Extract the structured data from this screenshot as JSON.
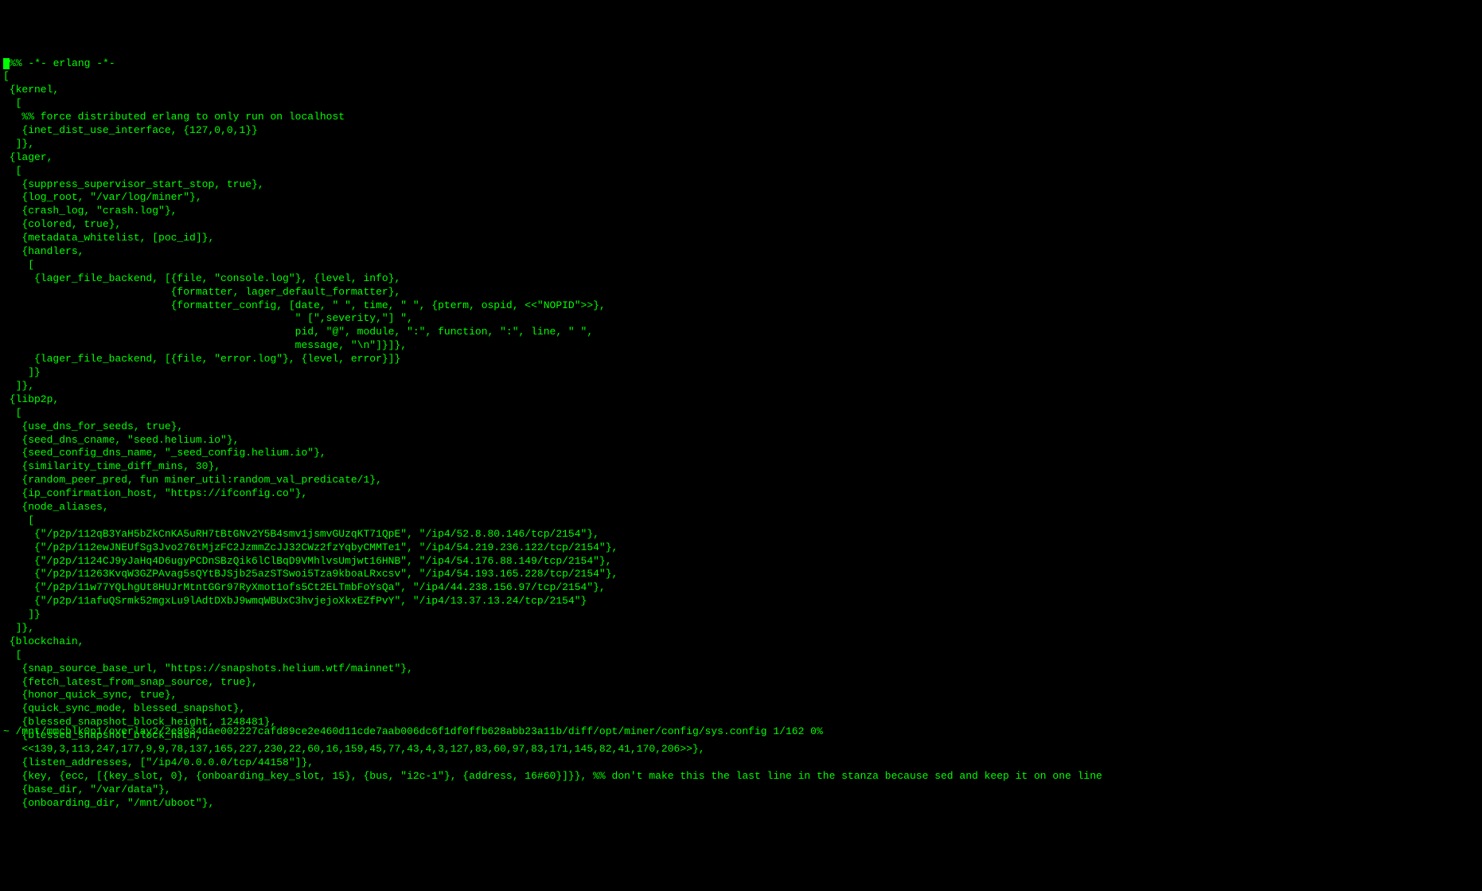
{
  "editor": {
    "lines": [
      "%% -*- erlang -*-",
      "[",
      " {kernel,",
      "  [",
      "   %% force distributed erlang to only run on localhost",
      "   {inet_dist_use_interface, {127,0,0,1}}",
      "  ]},",
      " {lager,",
      "  [",
      "   {suppress_supervisor_start_stop, true},",
      "   {log_root, \"/var/log/miner\"},",
      "   {crash_log, \"crash.log\"},",
      "   {colored, true},",
      "   {metadata_whitelist, [poc_id]},",
      "   {handlers,",
      "    [",
      "     {lager_file_backend, [{file, \"console.log\"}, {level, info},",
      "                           {formatter, lager_default_formatter},",
      "                           {formatter_config, [date, \" \", time, \" \", {pterm, ospid, <<\"NOPID\">>},",
      "                                               \" [\",severity,\"] \",",
      "                                               pid, \"@\", module, \":\", function, \":\", line, \" \",",
      "                                               message, \"\\n\"]}]},",
      "     {lager_file_backend, [{file, \"error.log\"}, {level, error}]}",
      "    ]}",
      "  ]},",
      " {libp2p,",
      "  [",
      "   {use_dns_for_seeds, true},",
      "   {seed_dns_cname, \"seed.helium.io\"},",
      "   {seed_config_dns_name, \"_seed_config.helium.io\"},",
      "   {similarity_time_diff_mins, 30},",
      "   {random_peer_pred, fun miner_util:random_val_predicate/1},",
      "   {ip_confirmation_host, \"https://ifconfig.co\"},",
      "   {node_aliases,",
      "    [",
      "     {\"/p2p/112qB3YaH5bZkCnKA5uRH7tBtGNv2Y5B4smv1jsmvGUzqKT71QpE\", \"/ip4/52.8.80.146/tcp/2154\"},",
      "     {\"/p2p/112ewJNEUfSg3Jvo276tMjzFC2JzmmZcJJ32CWz2fzYqbyCMMTe1\", \"/ip4/54.219.236.122/tcp/2154\"},",
      "     {\"/p2p/1124CJ9yJaHq4D6ugyPCDnSBzQik6lClBqD9VMhlvsUmjwt16HNB\", \"/ip4/54.176.88.149/tcp/2154\"},",
      "     {\"/p2p/11263KvqW3GZPAvag5sQYtBJSjb25azSTSwoi5Tza9kboaLRxcsv\", \"/ip4/54.193.165.228/tcp/2154\"},",
      "     {\"/p2p/11w77YQLhgUt8HUJrMtntGGr97RyXmot1ofs5Ct2ELTmbFoYsQa\", \"/ip4/44.238.156.97/tcp/2154\"},",
      "     {\"/p2p/11afuQSrmk52mgxLu9lAdtDXbJ9wmqWBUxC3hvjejoXkxEZfPvY\", \"/ip4/13.37.13.24/tcp/2154\"}",
      "    ]}",
      "  ]},",
      " {blockchain,",
      "  [",
      "   {snap_source_base_url, \"https://snapshots.helium.wtf/mainnet\"},",
      "   {fetch_latest_from_snap_source, true},",
      "   {honor_quick_sync, true},",
      "   {quick_sync_mode, blessed_snapshot},",
      "   {blessed_snapshot_block_height, 1248481},",
      "   {blessed_snapshot_block_hash,",
      "   <<139,3,113,247,177,9,9,78,137,165,227,230,22,60,16,159,45,77,43,4,3,127,83,60,97,83,171,145,82,41,170,206>>},",
      "   {listen_addresses, [\"/ip4/0.0.0.0/tcp/44158\"]},",
      "   {key, {ecc, [{key_slot, 0}, {onboarding_key_slot, 15}, {bus, \"i2c-1\"}, {address, 16#60}]}}, %% don't make this the last line in the stanza because sed and keep it on one line",
      "   {base_dir, \"/var/data\"},",
      "   {onboarding_dir, \"/mnt/uboot\"},"
    ],
    "status": "~ /mnt/mmcblk0p1/overlay2/2e8034dae002227cafd89ce2e460d11cde7aab006dc6f1df0ffb628abb23a11b/diff/opt/miner/config/sys.config 1/162 0%"
  }
}
